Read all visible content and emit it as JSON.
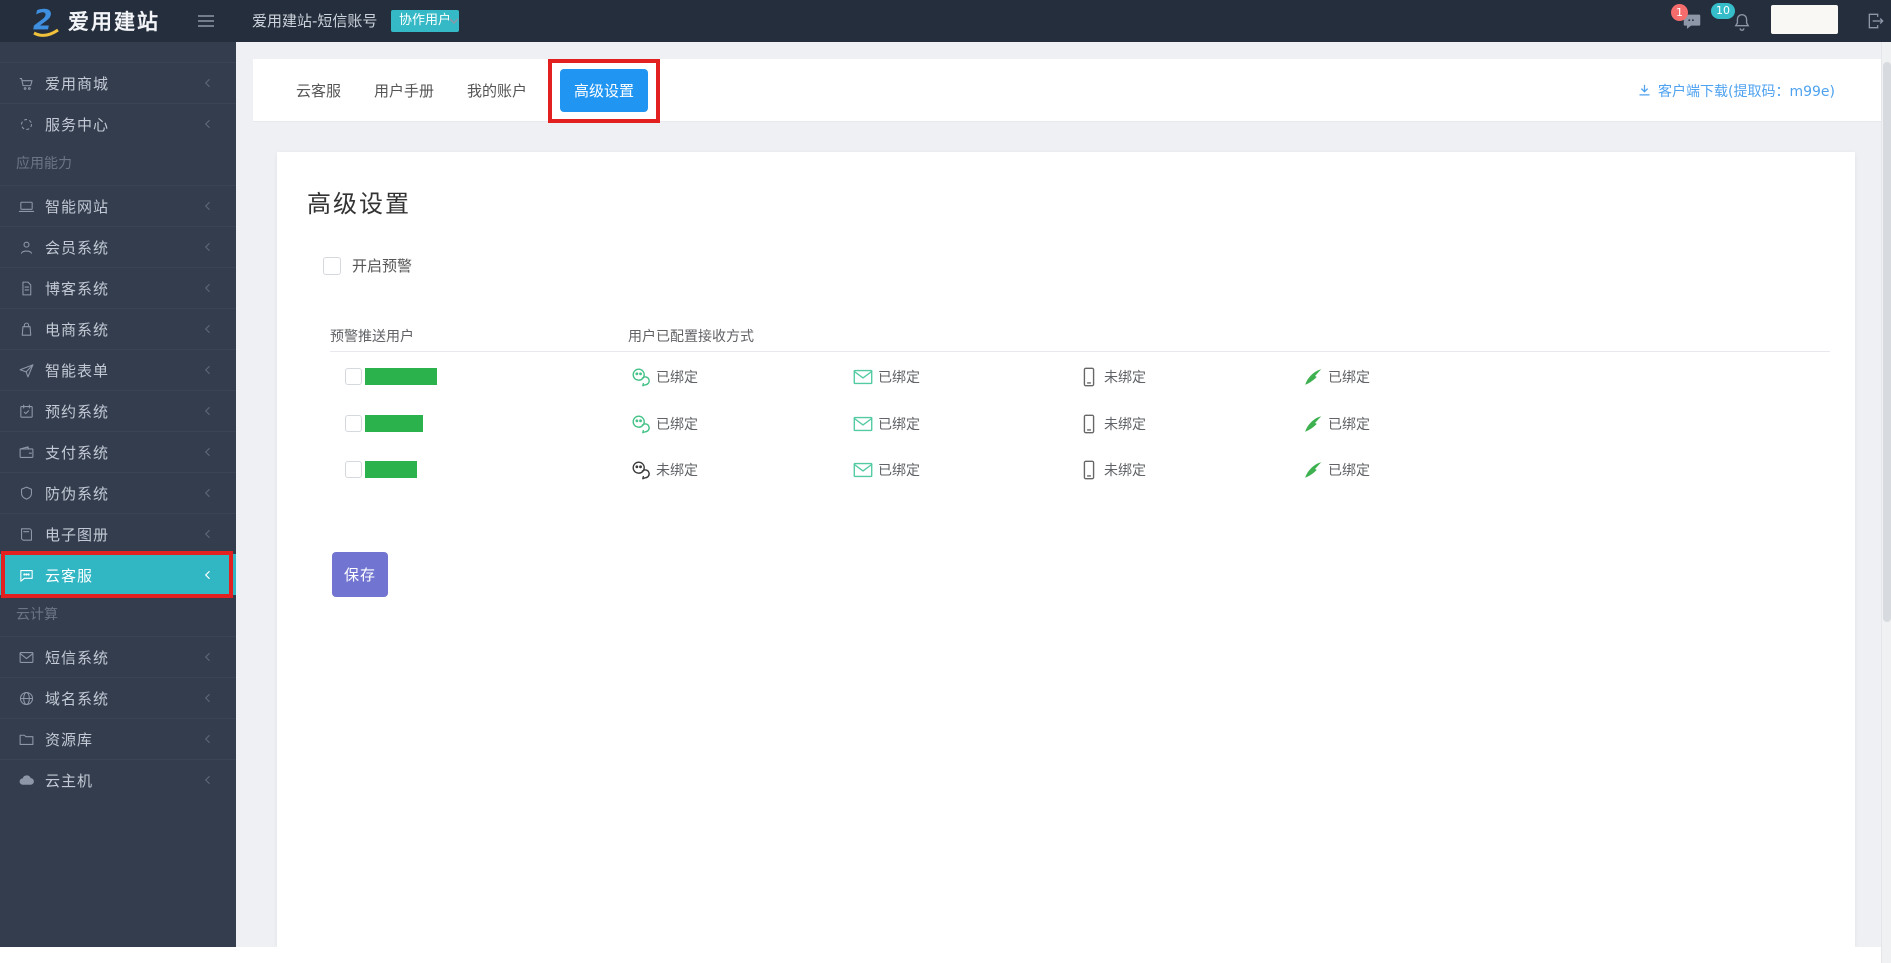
{
  "colors": {
    "topbar_bg": "#242e3d",
    "sidebar_bg": "#333d4e",
    "accent_teal": "#31b7c4",
    "role_badge_teal": "#35b9c6",
    "notification_teal": "#35bdc9",
    "badge_red": "#f56c6c",
    "annotation_red": "#e32020",
    "active_tab_blue": "#2095f2",
    "link_blue": "#4ea2f0",
    "save_purple": "#7175d1",
    "redaction_green": "#2bb24c",
    "wechat_green": "#45c287",
    "envelope_mint": "#53cba2",
    "wing_green": "#3db04f",
    "page_bg": "#eef0f3"
  },
  "topbar": {
    "logo_icon": "aiyong-logo-icon",
    "logo_text": "爱用建站",
    "hamburger_icon": "hamburger-icon",
    "breadcrumb": "爱用建站-短信账号",
    "role_badge": "协作用户",
    "role_caret_icon": "caret-down-icon",
    "message_icon": "message-icon",
    "message_badge": "1",
    "notification_icon": "bell-icon",
    "notification_badge": "10",
    "logout_icon": "logout-icon"
  },
  "sidebar": {
    "sections": [
      {
        "header": "",
        "items": [
          {
            "icon": "cart-icon",
            "label": "爱用商城"
          },
          {
            "icon": "spinner-icon",
            "label": "服务中心"
          }
        ]
      },
      {
        "header": "应用能力",
        "items": [
          {
            "icon": "laptop-icon",
            "label": "智能网站"
          },
          {
            "icon": "user-icon",
            "label": "会员系统"
          },
          {
            "icon": "document-icon",
            "label": "博客系统"
          },
          {
            "icon": "bag-icon",
            "label": "电商系统"
          },
          {
            "icon": "paper-plane-icon",
            "label": "智能表单"
          },
          {
            "icon": "calendar-icon",
            "label": "预约系统"
          },
          {
            "icon": "wallet-icon",
            "label": "支付系统"
          },
          {
            "icon": "shield-icon",
            "label": "防伪系统"
          },
          {
            "icon": "album-icon",
            "label": "电子图册"
          },
          {
            "icon": "chat-bubble-icon",
            "label": "云客服",
            "active": true,
            "annotated": true
          }
        ]
      },
      {
        "header": "云计算",
        "items": [
          {
            "icon": "mail-icon",
            "label": "短信系统"
          },
          {
            "icon": "globe-icon",
            "label": "域名系统"
          },
          {
            "icon": "folder-icon",
            "label": "资源库"
          },
          {
            "icon": "cloud-icon",
            "label": "云主机"
          }
        ]
      }
    ]
  },
  "tab_bar": {
    "tabs": [
      {
        "label": "云客服"
      },
      {
        "label": "用户手册"
      },
      {
        "label": "我的账户"
      },
      {
        "label": "高级设置",
        "active": true,
        "annotated": true
      }
    ],
    "download_icon": "download-icon",
    "download_link": "客户端下载(提取码：m99e)"
  },
  "panel": {
    "title": "高级设置",
    "enable_warning_label": "开启预警",
    "enable_warning_checked": false,
    "table": {
      "col1_header": "预警推送用户",
      "col2_header": "用户已配置接收方式",
      "rows": [
        {
          "name_redacted": true,
          "redaction_width": 72,
          "checked": false,
          "statuses": [
            {
              "icon": "wechat-icon",
              "label": "已绑定",
              "bound": true
            },
            {
              "icon": "envelope-icon",
              "label": "已绑定",
              "bound": true
            },
            {
              "icon": "phone-icon",
              "label": "未绑定",
              "bound": false
            },
            {
              "icon": "wing-icon",
              "label": "已绑定",
              "bound": true
            }
          ]
        },
        {
          "name_redacted": true,
          "redaction_width": 58,
          "checked": false,
          "statuses": [
            {
              "icon": "wechat-icon",
              "label": "已绑定",
              "bound": true
            },
            {
              "icon": "envelope-icon",
              "label": "已绑定",
              "bound": true
            },
            {
              "icon": "phone-icon",
              "label": "未绑定",
              "bound": false
            },
            {
              "icon": "wing-icon",
              "label": "已绑定",
              "bound": true
            }
          ]
        },
        {
          "name_redacted": true,
          "redaction_width": 52,
          "checked": false,
          "statuses": [
            {
              "icon": "wechat-icon",
              "label": "未绑定",
              "bound": false
            },
            {
              "icon": "envelope-icon",
              "label": "已绑定",
              "bound": true
            },
            {
              "icon": "phone-icon",
              "label": "未绑定",
              "bound": false
            },
            {
              "icon": "wing-icon",
              "label": "已绑定",
              "bound": true
            }
          ]
        }
      ]
    },
    "save_label": "保存"
  }
}
